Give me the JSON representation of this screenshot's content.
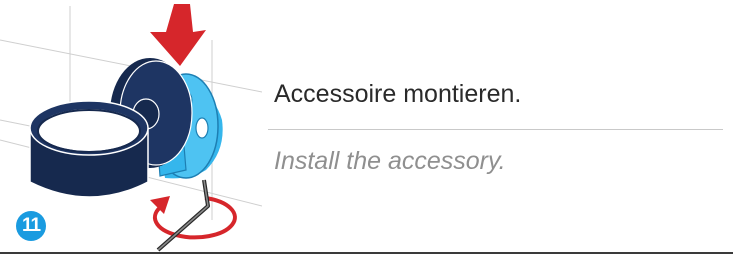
{
  "step": {
    "number": "11"
  },
  "instruction": {
    "german": "Accessoire montieren.",
    "english": "Install the accessory."
  },
  "colors": {
    "arrow_red": "#d6262b",
    "ring_navy": "#16294e",
    "mount_blue": "#35b6ec",
    "badge_blue": "#1a9be0"
  },
  "icons": {
    "press_arrow": "down-arrow-icon",
    "rotate_arrow": "rotate-arrow-icon"
  }
}
